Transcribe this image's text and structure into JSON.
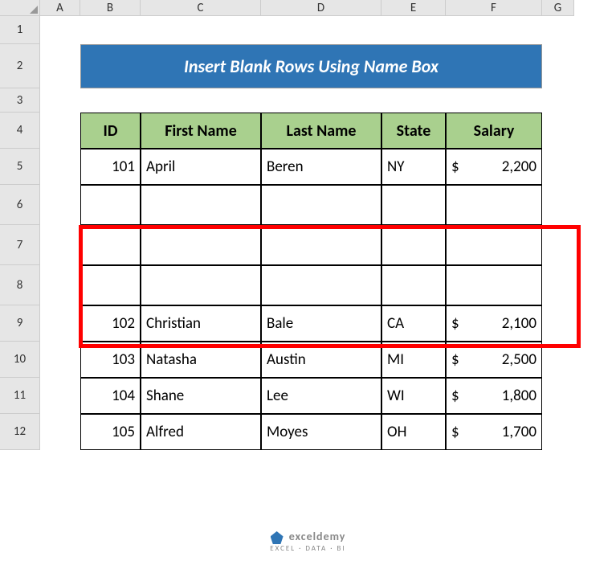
{
  "columns": [
    "A",
    "B",
    "C",
    "D",
    "E",
    "F",
    "G"
  ],
  "rows": [
    "1",
    "2",
    "3",
    "4",
    "5",
    "6",
    "7",
    "8",
    "9",
    "10",
    "11",
    "12"
  ],
  "title": "Insert Blank Rows Using Name Box",
  "headers": {
    "id": "ID",
    "first_name": "First Name",
    "last_name": "Last Name",
    "state": "State",
    "salary": "Salary"
  },
  "data": [
    {
      "id": "101",
      "first": "April",
      "last": "Beren",
      "state": "NY",
      "salary": "2,200"
    },
    {
      "id": "",
      "first": "",
      "last": "",
      "state": "",
      "salary": ""
    },
    {
      "id": "",
      "first": "",
      "last": "",
      "state": "",
      "salary": ""
    },
    {
      "id": "",
      "first": "",
      "last": "",
      "state": "",
      "salary": ""
    },
    {
      "id": "102",
      "first": "Christian",
      "last": "Bale",
      "state": "CA",
      "salary": "2,100"
    },
    {
      "id": "103",
      "first": "Natasha",
      "last": "Austin",
      "state": "MI",
      "salary": "2,500"
    },
    {
      "id": "104",
      "first": "Shane",
      "last": "Lee",
      "state": "WI",
      "salary": "1,800"
    },
    {
      "id": "105",
      "first": "Alfred",
      "last": "Moyes",
      "state": "OH",
      "salary": "1,700"
    }
  ],
  "currency": "$",
  "watermark": "exceldemy",
  "watermark_sub": "EXCEL · DATA · BI"
}
